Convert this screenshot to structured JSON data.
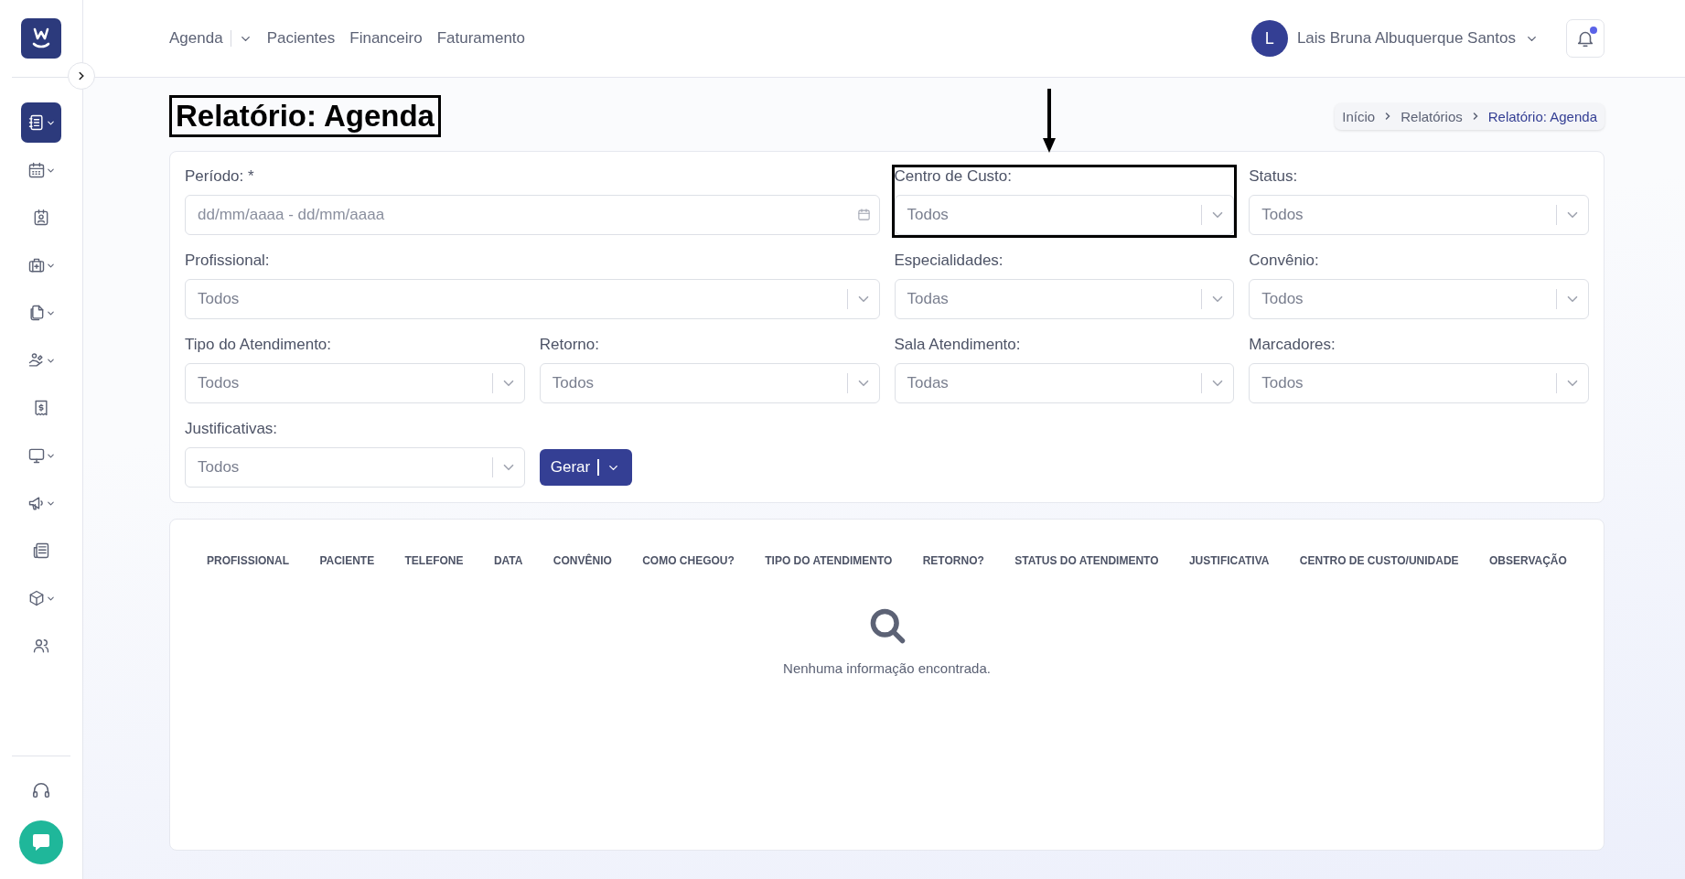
{
  "sidebar": {
    "items": [
      {
        "kind": "menu",
        "selected": true
      },
      {
        "kind": "menu",
        "selected": false
      },
      {
        "kind": "link",
        "selected": false
      },
      {
        "kind": "menu",
        "selected": false
      },
      {
        "kind": "menu",
        "selected": false
      },
      {
        "kind": "menu",
        "selected": false
      },
      {
        "kind": "link",
        "selected": false
      },
      {
        "kind": "menu",
        "selected": false
      },
      {
        "kind": "menu",
        "selected": false
      },
      {
        "kind": "link",
        "selected": false
      },
      {
        "kind": "menu",
        "selected": false
      },
      {
        "kind": "link",
        "selected": false
      }
    ]
  },
  "nav": {
    "items": [
      {
        "label": "Agenda",
        "kind": "dropdown"
      },
      {
        "label": "Pacientes",
        "kind": "link"
      },
      {
        "label": "Financeiro",
        "kind": "link"
      },
      {
        "label": "Faturamento",
        "kind": "link"
      }
    ]
  },
  "user": {
    "initial": "L",
    "name": "Lais Bruna Albuquerque Santos"
  },
  "notifications": {
    "unread": true
  },
  "page_title": {
    "text": "Relatório: Agenda",
    "highlighted": true
  },
  "breadcrumb": [
    {
      "label": "Início",
      "selected": false
    },
    {
      "label": "Relatórios",
      "selected": false
    },
    {
      "label": "Relatório: Agenda",
      "selected": true
    }
  ],
  "filters": [
    {
      "label": "Período: *",
      "kind": "date-range",
      "placeholder": "dd/mm/aaaa - dd/mm/aaaa",
      "highlighted": false
    },
    {
      "label": "Centro de Custo:",
      "kind": "select",
      "value": "Todos",
      "highlighted": true
    },
    {
      "label": "Status:",
      "kind": "select",
      "value": "Todos",
      "highlighted": false
    },
    {
      "label": "Profissional:",
      "kind": "select",
      "value": "Todos",
      "highlighted": false
    },
    {
      "label": "Especialidades:",
      "kind": "select",
      "value": "Todas",
      "highlighted": false
    },
    {
      "label": "Convênio:",
      "kind": "select",
      "value": "Todos",
      "highlighted": false
    },
    {
      "label": "Tipo do Atendimento:",
      "kind": "select",
      "value": "Todos",
      "highlighted": false
    },
    {
      "label": "Retorno:",
      "kind": "select",
      "value": "Todos",
      "highlighted": false
    },
    {
      "label": "Sala Atendimento:",
      "kind": "select",
      "value": "Todas",
      "highlighted": false
    },
    {
      "label": "Marcadores:",
      "kind": "select",
      "value": "Todos",
      "highlighted": false
    },
    {
      "label": "Justificativas:",
      "kind": "select",
      "value": "Todos",
      "highlighted": false
    }
  ],
  "generate_button": {
    "label": "Gerar"
  },
  "table": {
    "columns": [
      "PROFISSIONAL",
      "PACIENTE",
      "TELEFONE",
      "DATA",
      "CONVÊNIO",
      "COMO CHEGOU?",
      "TIPO DO ATENDIMENTO",
      "RETORNO?",
      "STATUS DO ATENDIMENTO",
      "JUSTIFICATIVA",
      "CENTRO DE CUSTO/UNIDADE",
      "OBSERVAÇÃO"
    ],
    "empty_message": "Nenhuma informação encontrada."
  }
}
